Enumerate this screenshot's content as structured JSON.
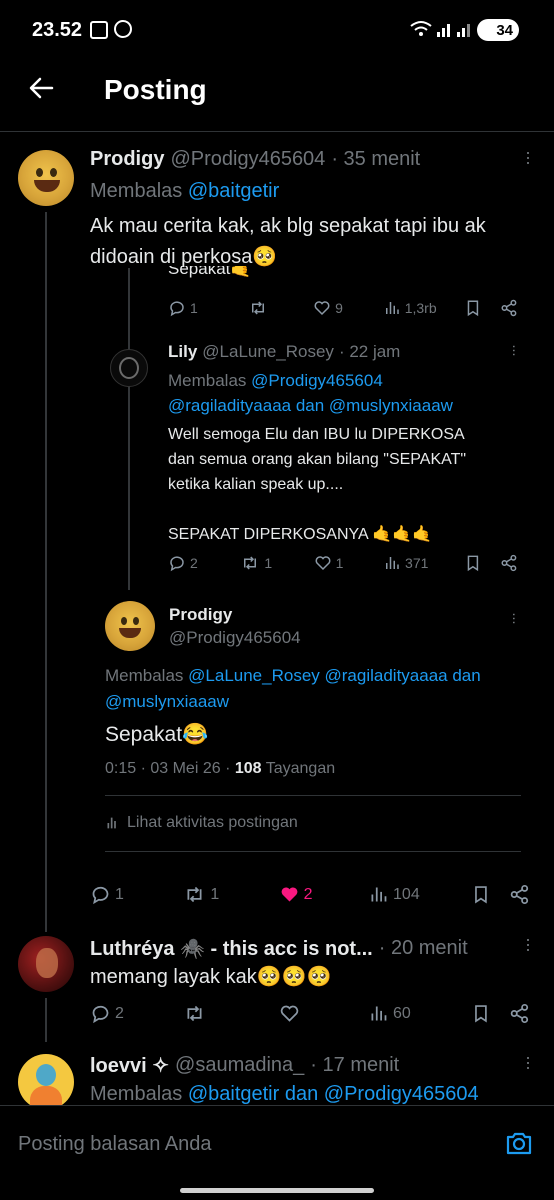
{
  "status_bar": {
    "time": "23.52",
    "battery": "34"
  },
  "header": {
    "title": "Posting"
  },
  "main_reply": {
    "name": "Prodigy",
    "handle": "@Prodigy465604",
    "time": "· 35 menit",
    "replying_prefix": "Membalas",
    "replying_to": "@baitgetir",
    "text_line1": "Ak mau cerita kak, ak blg sepakat tapi ibu ak",
    "text_line2": "didoain di perkosa🥺"
  },
  "quoted_thread": {
    "clipped_text": "Sepakat🤙",
    "stats": {
      "replies": "1",
      "likes": "9",
      "views": "1,3rb"
    },
    "lily": {
      "name": "Lily",
      "handle": "@LaLune_Rosey",
      "time": "· 22 jam",
      "replying_prefix": "Membalas",
      "replying_to_line1": "@Prodigy465604",
      "replying_to_line2": "@ragiladityaaaa dan @muslynxiaaaw",
      "text_line1": "Well semoga Elu dan IBU lu DIPERKOSA",
      "text_line2": "dan semua orang akan bilang \"SEPAKAT\"",
      "text_line3": "ketika kalian speak up....",
      "text_line4": "SEPAKAT DIPERKOSANYA 🤙🤙🤙",
      "stats": {
        "replies": "2",
        "reposts": "1",
        "likes": "1",
        "views": "371"
      }
    },
    "prodigy": {
      "name": "Prodigy",
      "handle": "@Prodigy465604",
      "replying_prefix": "Membalas",
      "replying_to_line1": "@LaLune_Rosey @ragiladityaaaa dan",
      "replying_to_line2": "@muslynxiaaaw",
      "text": "Sepakat😂",
      "timestamp": "0:15 · 03 Mei 26 ·",
      "views_count": "108",
      "views_label": "Tayangan",
      "activity": "Lihat aktivitas postingan"
    }
  },
  "main_stats": {
    "replies": "1",
    "reposts": "1",
    "likes": "2",
    "views": "104"
  },
  "reply2": {
    "name": "Luthréya 🕷️ - this acc is not...",
    "time": "· 20 menit",
    "text": "memang layak kak🥺🥺🥺",
    "stats": {
      "replies": "2",
      "views": "60"
    }
  },
  "reply3": {
    "name": "loevvi ✧",
    "handle": "@saumadina_",
    "time": "· 17 menit",
    "replying_prefix": "Membalas",
    "replying_to": "@baitgetir dan @Prodigy465604"
  },
  "composer": {
    "placeholder": "Posting balasan Anda"
  },
  "colors": {
    "accent": "#1d9bf0",
    "like": "#f91880",
    "background": "#000000",
    "muted": "#71767b"
  }
}
